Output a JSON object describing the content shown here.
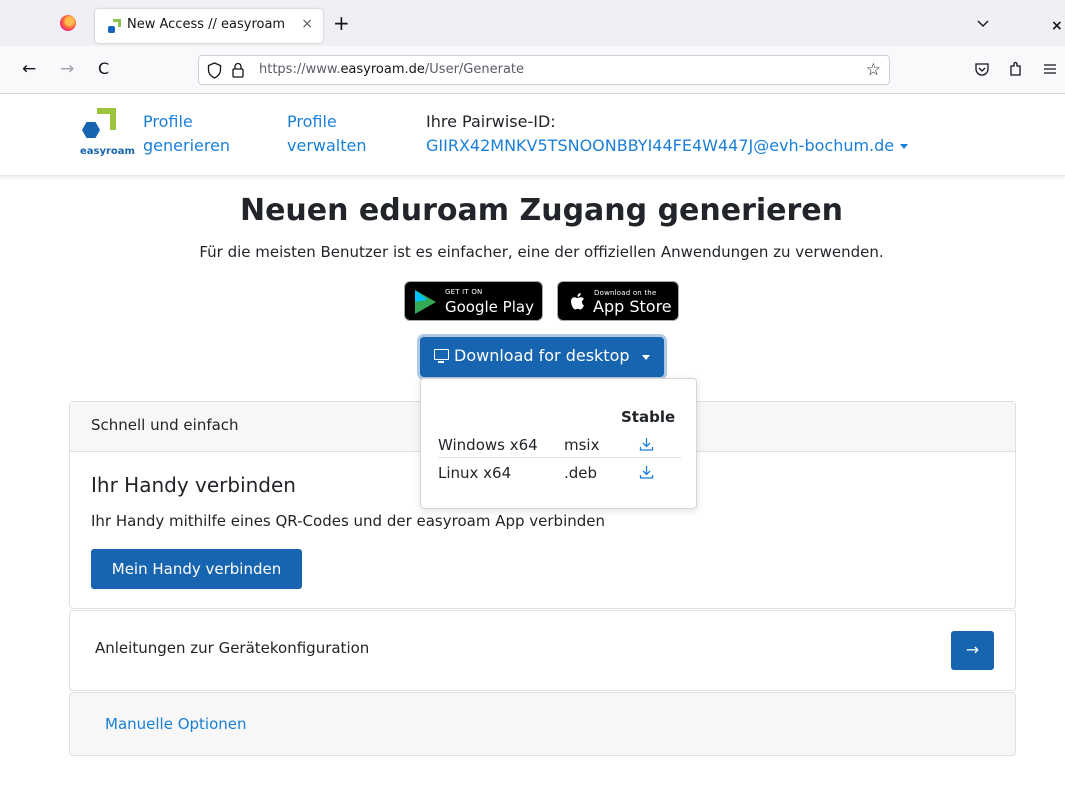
{
  "browser": {
    "tab_title": "New Access // easyroam",
    "tab_close": "×",
    "new_tab": "+",
    "window_close": "×",
    "url_prefix": "https://www.",
    "url_domain": "easyroam.de",
    "url_path": "/User/Generate",
    "back": "←",
    "forward": "→",
    "reload": "C",
    "bookmark_star": "☆"
  },
  "header": {
    "logo_text": "easyroam",
    "nav_profile_generate_line1": "Profile",
    "nav_profile_generate_line2": "generieren",
    "nav_profile_manage_line1": "Profile",
    "nav_profile_manage_line2": "verwalten",
    "pairwise_label": "Ihre Pairwise-ID:",
    "pairwise_id": "GIIRX42MNKV5TSNOONBBYI44FE4W447J@evh-bochum.de"
  },
  "main": {
    "title": "Neuen eduroam Zugang generieren",
    "lead": "Für die meisten Benutzer ist es einfacher, eine der offiziellen Anwendungen zu verwenden.",
    "google_play_small": "GET IT ON",
    "google_play_big": "Google Play",
    "app_store_small": "Download on the",
    "app_store_big": "App Store",
    "download_button": "Download for desktop"
  },
  "dropdown": {
    "column_header": "Stable",
    "rows": [
      {
        "os": "Windows x64",
        "format": "msix"
      },
      {
        "os": "Linux x64",
        "format": ".deb"
      }
    ]
  },
  "card": {
    "header": "Schnell und einfach",
    "title": "Ihr Handy verbinden",
    "text": "Ihr Handy mithilfe eines QR-Codes und der easyroam App verbinden",
    "button": "Mein Handy verbinden"
  },
  "instructions": {
    "label": "Anleitungen zur Gerätekonfiguration",
    "arrow": "→"
  },
  "options": {
    "label": "Manuelle Optionen"
  },
  "colors": {
    "primary": "#1764b0",
    "link": "#1a7fd8",
    "logo_green": "#9bc53d"
  }
}
